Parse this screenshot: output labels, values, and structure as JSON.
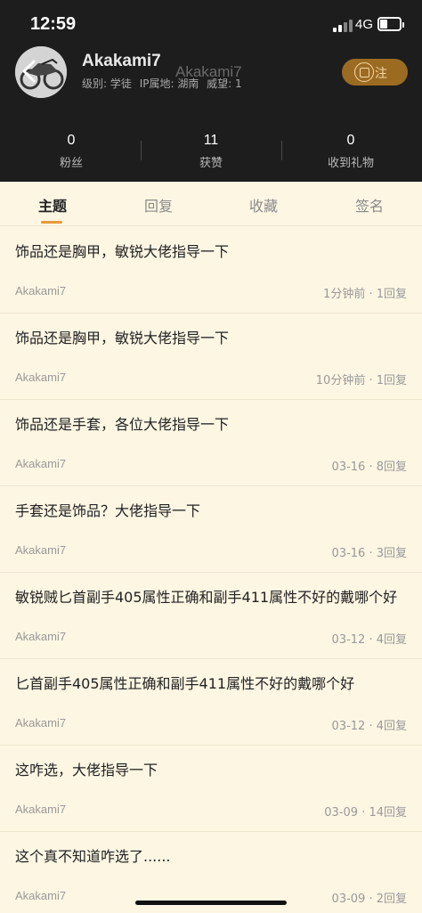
{
  "status_bar": {
    "time": "12:59",
    "network": "4G"
  },
  "profile": {
    "username": "Akakami7",
    "username_overlay": "Akakami7",
    "level_label": "级别: 学徒",
    "ip_label": "IP属地: 湖南",
    "prestige_label": "威望: 1",
    "follow_label": "注"
  },
  "stats": [
    {
      "value": "0",
      "label": "粉丝"
    },
    {
      "value": "11",
      "label": "获赞"
    },
    {
      "value": "0",
      "label": "收到礼物"
    }
  ],
  "tabs": [
    {
      "label": "主题",
      "active": true
    },
    {
      "label": "回复",
      "active": false
    },
    {
      "label": "收藏",
      "active": false
    },
    {
      "label": "签名",
      "active": false
    }
  ],
  "posts": [
    {
      "title": "饰品还是胸甲，敏锐大佬指导一下",
      "author": "Akakami7",
      "info": "1分钟前 · 1回复"
    },
    {
      "title": "饰品还是胸甲，敏锐大佬指导一下",
      "author": "Akakami7",
      "info": "10分钟前 · 1回复"
    },
    {
      "title": "饰品还是手套，各位大佬指导一下",
      "author": "Akakami7",
      "info": "03-16 · 8回复"
    },
    {
      "title": "手套还是饰品？大佬指导一下",
      "author": "Akakami7",
      "info": "03-16 · 3回复"
    },
    {
      "title": "敏锐贼匕首副手405属性正确和副手411属性不好的戴哪个好",
      "author": "Akakami7",
      "info": "03-12 · 4回复"
    },
    {
      "title": "匕首副手405属性正确和副手411属性不好的戴哪个好",
      "author": "Akakami7",
      "info": "03-12 · 4回复"
    },
    {
      "title": "这咋选，大佬指导一下",
      "author": "Akakami7",
      "info": "03-09 · 14回复"
    },
    {
      "title": "这个真不知道咋选了......",
      "author": "Akakami7",
      "info": "03-09 · 2回复"
    }
  ],
  "colors": {
    "header_bg": "#1d1d1d",
    "page_bg": "#fdf6e3",
    "accent": "#e89a3c",
    "follow_bg": "#9c6b22"
  }
}
